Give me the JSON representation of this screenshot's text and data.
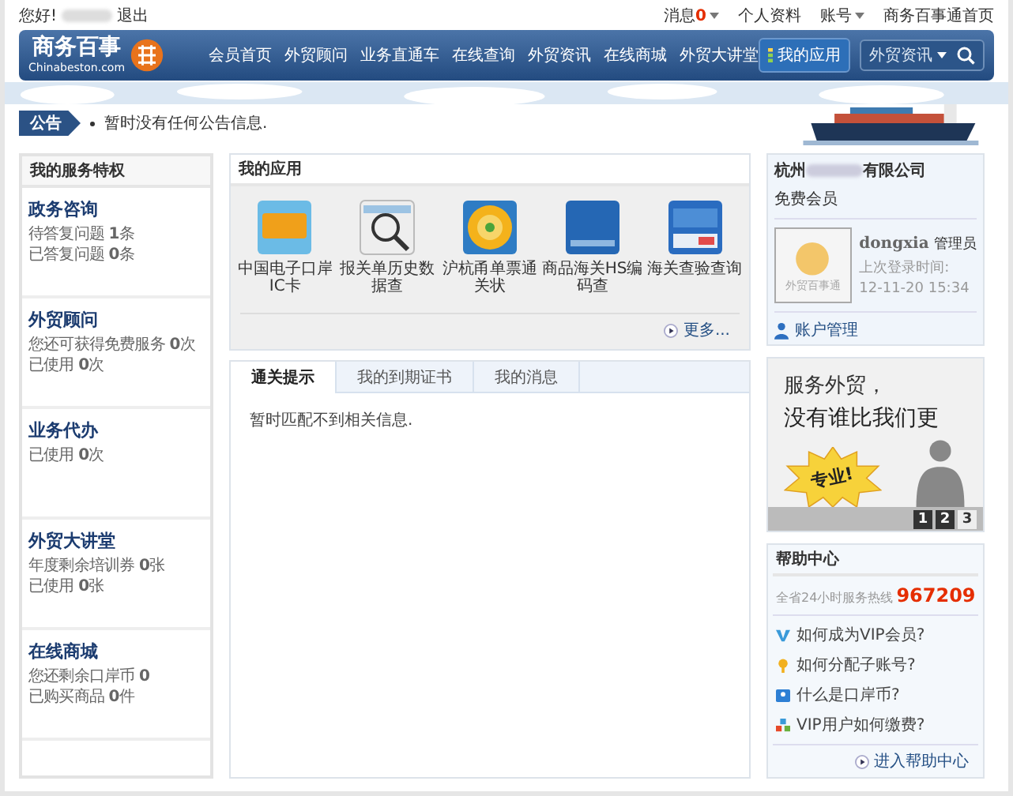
{
  "topbar": {
    "greeting": "您好!",
    "logout": "退出",
    "links": [
      {
        "label": "消息",
        "count": "0",
        "dropdown": true
      },
      {
        "label": "个人资料",
        "dropdown": false
      },
      {
        "label": "账号",
        "dropdown": true
      },
      {
        "label": "商务百事通首页",
        "dropdown": false
      }
    ]
  },
  "logo": {
    "name": "商务百事",
    "domain": "Chinabeston.com"
  },
  "nav": [
    "会员首页",
    "外贸顾问",
    "业务直通车",
    "在线查询",
    "外贸资讯",
    "在线商城",
    "外贸大讲堂"
  ],
  "my_apps_button": "我的应用",
  "search": {
    "category": "外贸资讯"
  },
  "notice": {
    "label": "公告",
    "text": "暂时没有任何公告信息."
  },
  "services": {
    "title": "我的服务特权",
    "sections": [
      {
        "title": "政务咨询",
        "lines": [
          "待答复问题 **1**条",
          "已答复问题 **0**条"
        ]
      },
      {
        "title": "外贸顾问",
        "lines": [
          "您还可获得免费服务 **0**次",
          "已使用 **0**次"
        ]
      },
      {
        "title": "业务代办",
        "lines": [
          "已使用 **0**次"
        ]
      },
      {
        "title": "外贸大讲堂",
        "lines": [
          "年度剩余培训券 **0**张",
          "已使用 **0**张"
        ]
      },
      {
        "title": "在线商城",
        "lines": [
          "您还剩余口岸币 **0**",
          "已购买商品 **0**件"
        ]
      }
    ]
  },
  "apps": {
    "title": "我的应用",
    "items": [
      {
        "kind": "ic",
        "label": "中国电子口岸IC卡"
      },
      {
        "kind": "calendar",
        "label": "报关单历史数据查"
      },
      {
        "kind": "target",
        "label": "沪杭甬单票通关状"
      },
      {
        "kind": "sh",
        "label": "商品海关HS编码查"
      },
      {
        "kind": "ticket",
        "label": "海关查验查询"
      }
    ],
    "more": "更多..."
  },
  "tabs": [
    {
      "label": "通关提示",
      "selected": true
    },
    {
      "label": "我的到期证书",
      "selected": false
    },
    {
      "label": "我的消息",
      "selected": false
    }
  ],
  "tab_message": "暂时匹配不到相关信息.",
  "account": {
    "company_start": "杭州",
    "company_end": "有限公司",
    "level": "免费会员",
    "avatar_caption": "外贸百事通",
    "user": "dongxia",
    "role": "管理员",
    "last_login_label": "上次登录时间:",
    "last_login": "12-11-20 15:34",
    "manage": "账户管理"
  },
  "ad": {
    "line1": "服务外贸，",
    "line2": "没有谁比我们更",
    "badge": "专业!",
    "pages": [
      {
        "label": "1",
        "selected": false
      },
      {
        "label": "2",
        "selected": false
      },
      {
        "label": "3",
        "selected": true
      }
    ]
  },
  "help": {
    "title": "帮助中心",
    "hotline_label": "全省24小时服务热线",
    "hotline": "967209",
    "links": [
      {
        "kind": "vip",
        "label": "如何成为VIP会员?"
      },
      {
        "kind": "key",
        "label": "如何分配子账号?"
      },
      {
        "kind": "card",
        "label": "什么是口岸币?"
      },
      {
        "kind": "blocks",
        "label": "VIP用户如何缴费?"
      }
    ],
    "enter": "进入帮助中心"
  }
}
